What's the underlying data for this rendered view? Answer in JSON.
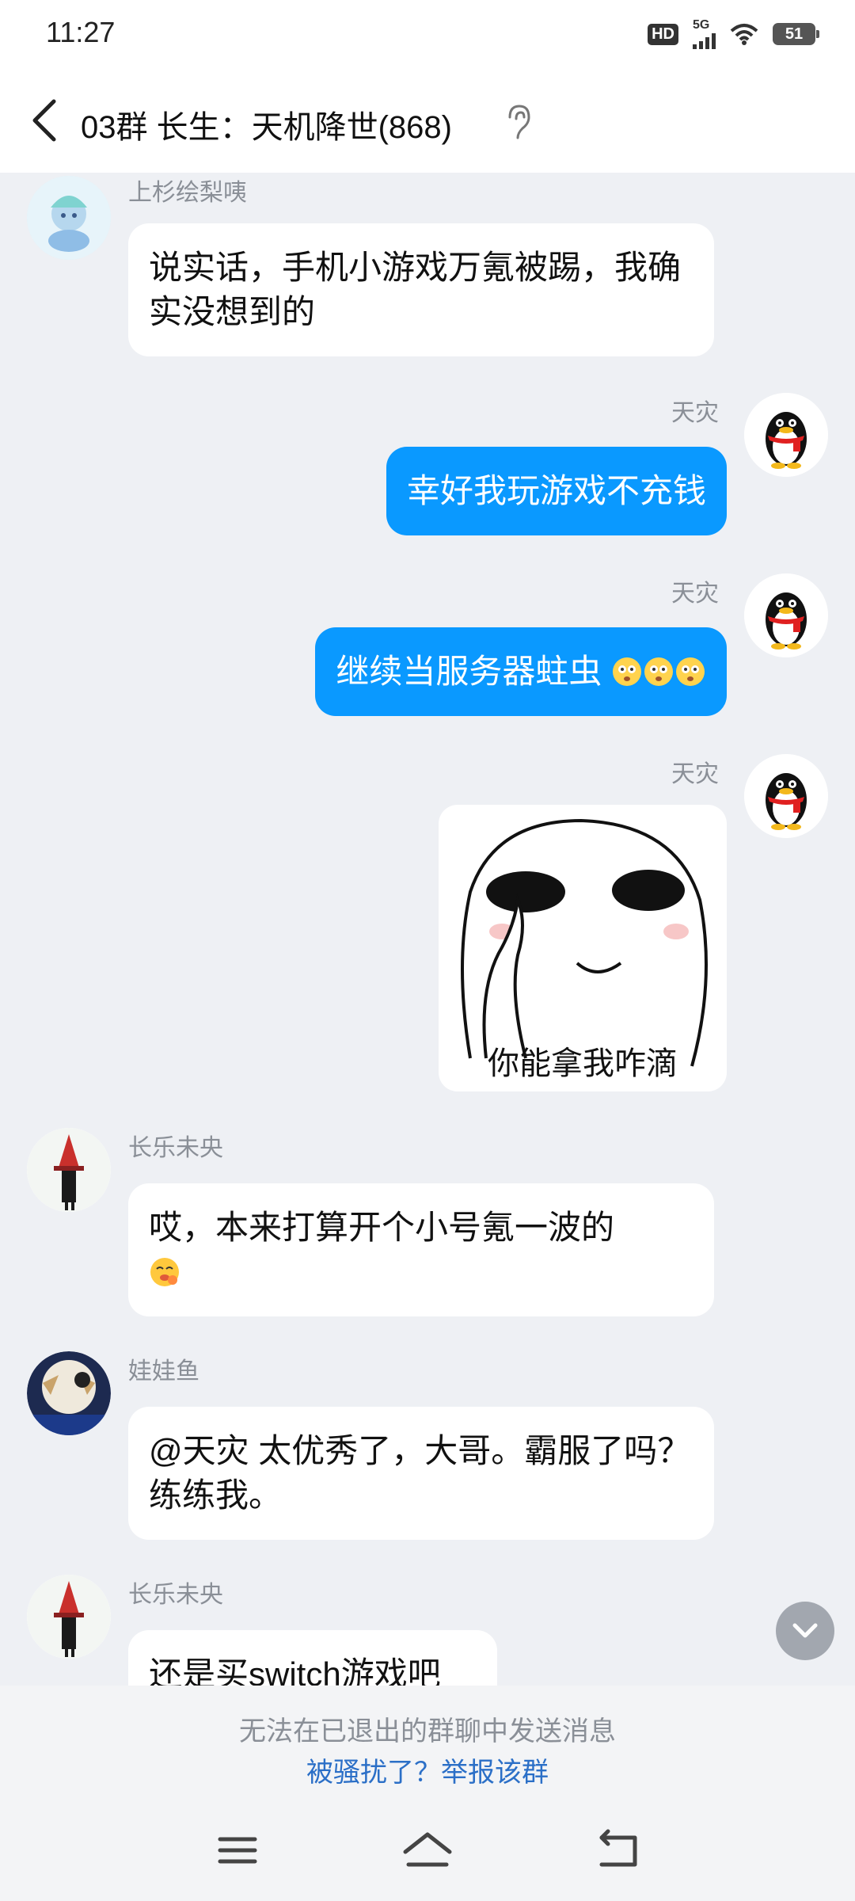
{
  "status_bar": {
    "time": "11:27",
    "hd": "HD",
    "network": "5G",
    "battery": "51"
  },
  "header": {
    "title": "03群 长生：天机降世(868)"
  },
  "messages": [
    {
      "sender": "上杉绘梨咦",
      "text": "说实话，手机小游戏万氪被踢，我确实没想到的"
    },
    {
      "sender": "天灾",
      "text": "幸好我玩游戏不充钱"
    },
    {
      "sender": "天灾",
      "text": "继续当服务器蛀虫"
    },
    {
      "sender": "天灾",
      "sticker_caption": "你能拿我咋滴"
    },
    {
      "sender": "长乐未央",
      "text": "哎，本来打算开个小号氪一波的"
    },
    {
      "sender": "娃娃鱼",
      "text": "@天灾 太优秀了，大哥。霸服了吗？练练我。"
    },
    {
      "sender": "长乐未央",
      "text": "还是买switch游戏吧"
    }
  ],
  "footer": {
    "notice": "无法在已退出的群聊中发送消息",
    "report_link": "被骚扰了？举报该群"
  },
  "colors": {
    "outgoing_bubble": "#0a99ff",
    "link": "#2b6fc7"
  }
}
